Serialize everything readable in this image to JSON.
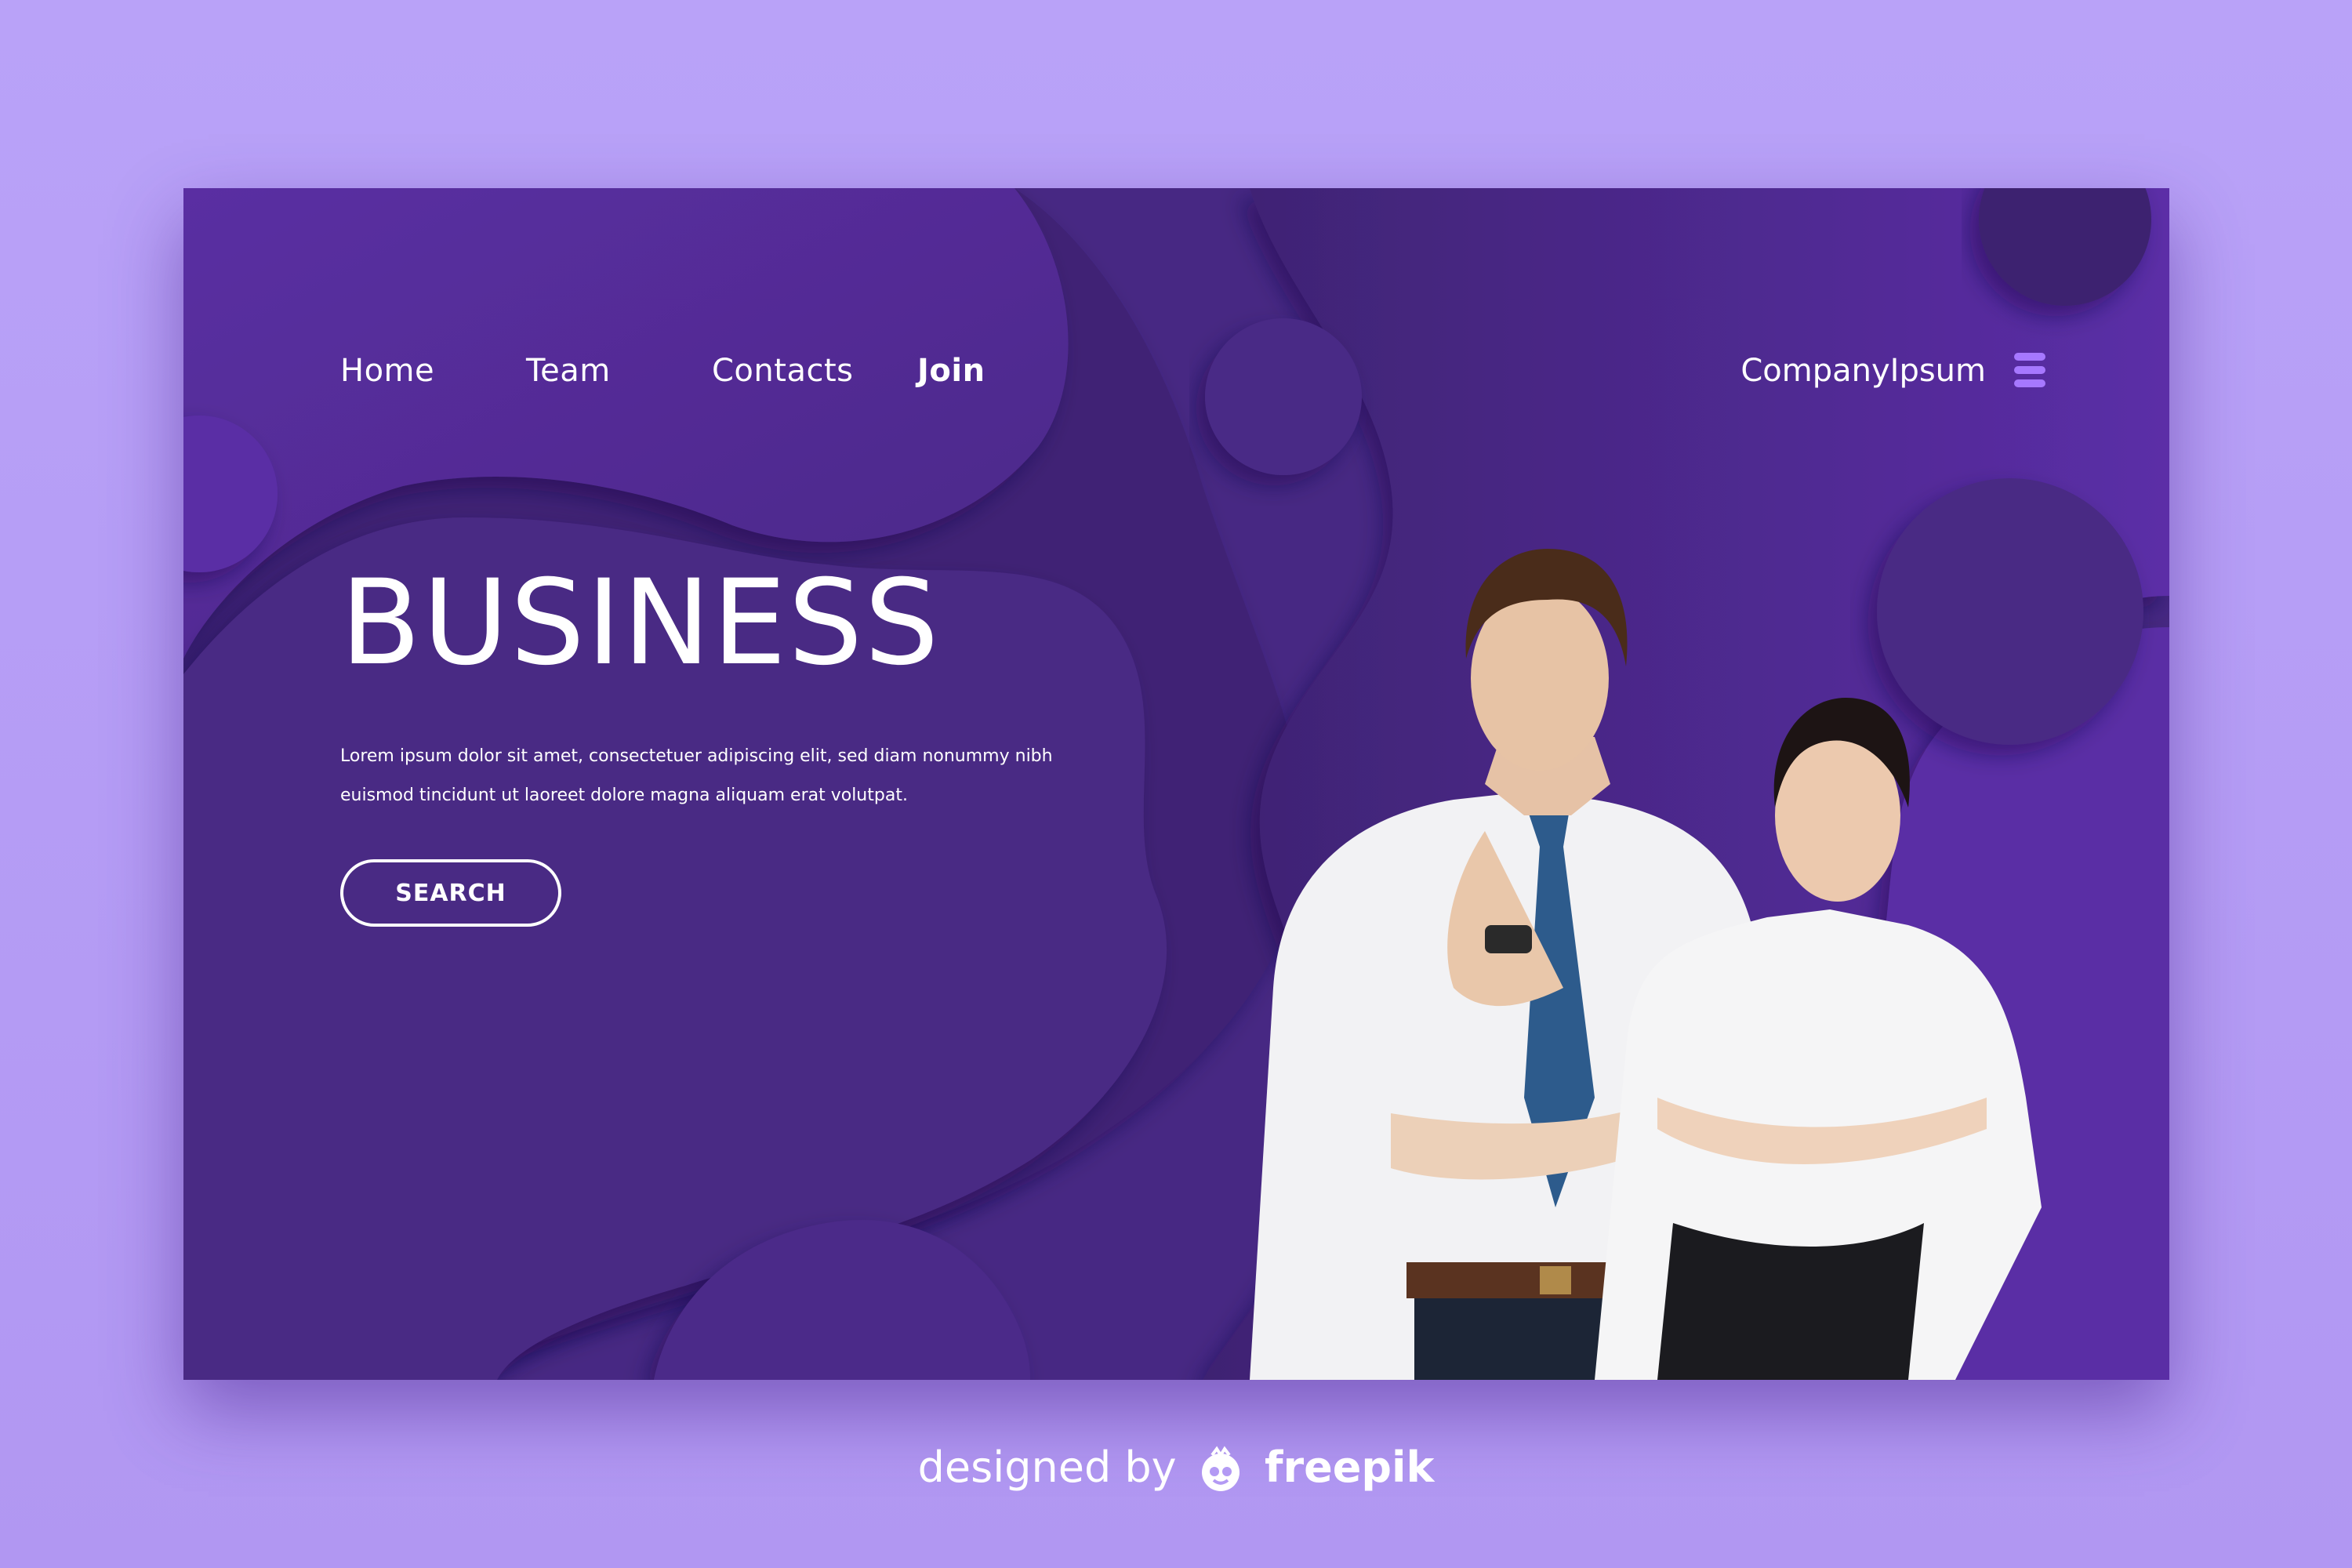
{
  "nav": {
    "links": [
      {
        "label": "Home"
      },
      {
        "label": "Team"
      },
      {
        "label": "Contacts"
      },
      {
        "label": "Join",
        "active": true
      }
    ],
    "brand": "CompanyIpsum",
    "menu_icon": "hamburger-icon"
  },
  "hero": {
    "title": "BUSINESS",
    "text_line1": "Lorem ipsum dolor sit amet, consectetuer adipiscing elit, sed diam nonummy nibh",
    "text_line2": "euismod tincidunt ut laoreet dolore magna aliquam erat volutpat.",
    "button_label": "SEARCH"
  },
  "footer": {
    "prefix": "designed by",
    "brand": "freepik",
    "icon": "freepik-logo-icon"
  },
  "colors": {
    "page_bg": "#b9a2f8",
    "card_bg": "#4a2a86",
    "blob_light": "#5c2ea6",
    "blob_dark": "#3f2475",
    "menu_accent": "#a678ff",
    "text": "#ffffff"
  }
}
